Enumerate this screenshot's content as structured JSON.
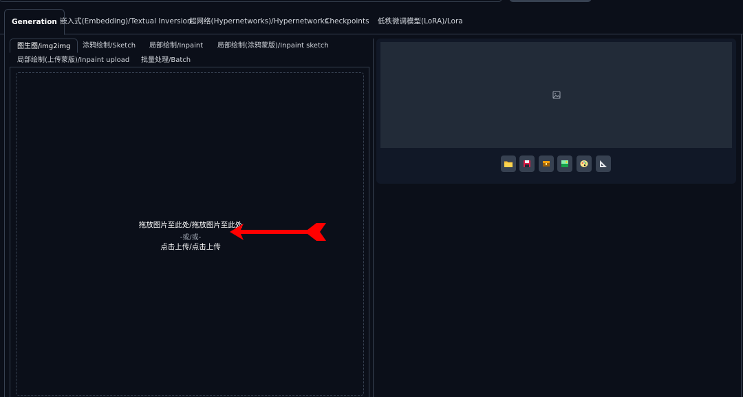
{
  "main_tabs": [
    {
      "label": "Generation",
      "active": true
    },
    {
      "label": "嵌入式(Embedding)/Textual Inversion"
    },
    {
      "label": "超网络(Hypernetworks)/Hypernetworks"
    },
    {
      "label": "Checkpoints"
    },
    {
      "label": "低秩微调模型(LoRA)/Lora"
    }
  ],
  "sub_tabs": [
    {
      "label": "图生图/img2img",
      "active": true
    },
    {
      "label": "涂鸦绘制/Sketch"
    },
    {
      "label": "局部绘制/Inpaint"
    },
    {
      "label": "局部绘制(涂鸦蒙版)/Inpaint sketch"
    },
    {
      "label": "局部绘制(上传蒙版)/Inpaint upload"
    },
    {
      "label": "批量处理/Batch"
    }
  ],
  "upload": {
    "drop_text": "拖放图片至此处/拖放图片至此处",
    "or_text": "-或/或-",
    "click_text": "点击上传/点击上传"
  },
  "output": {
    "image_icon": "image-placeholder-icon",
    "toolbar_icons": [
      "folder-icon",
      "save-icon",
      "zip-icon",
      "send-to-img2img-icon",
      "send-to-inpaint-icon",
      "send-to-extras-icon"
    ]
  },
  "annotation": {
    "arrow_color": "#ff0000"
  }
}
